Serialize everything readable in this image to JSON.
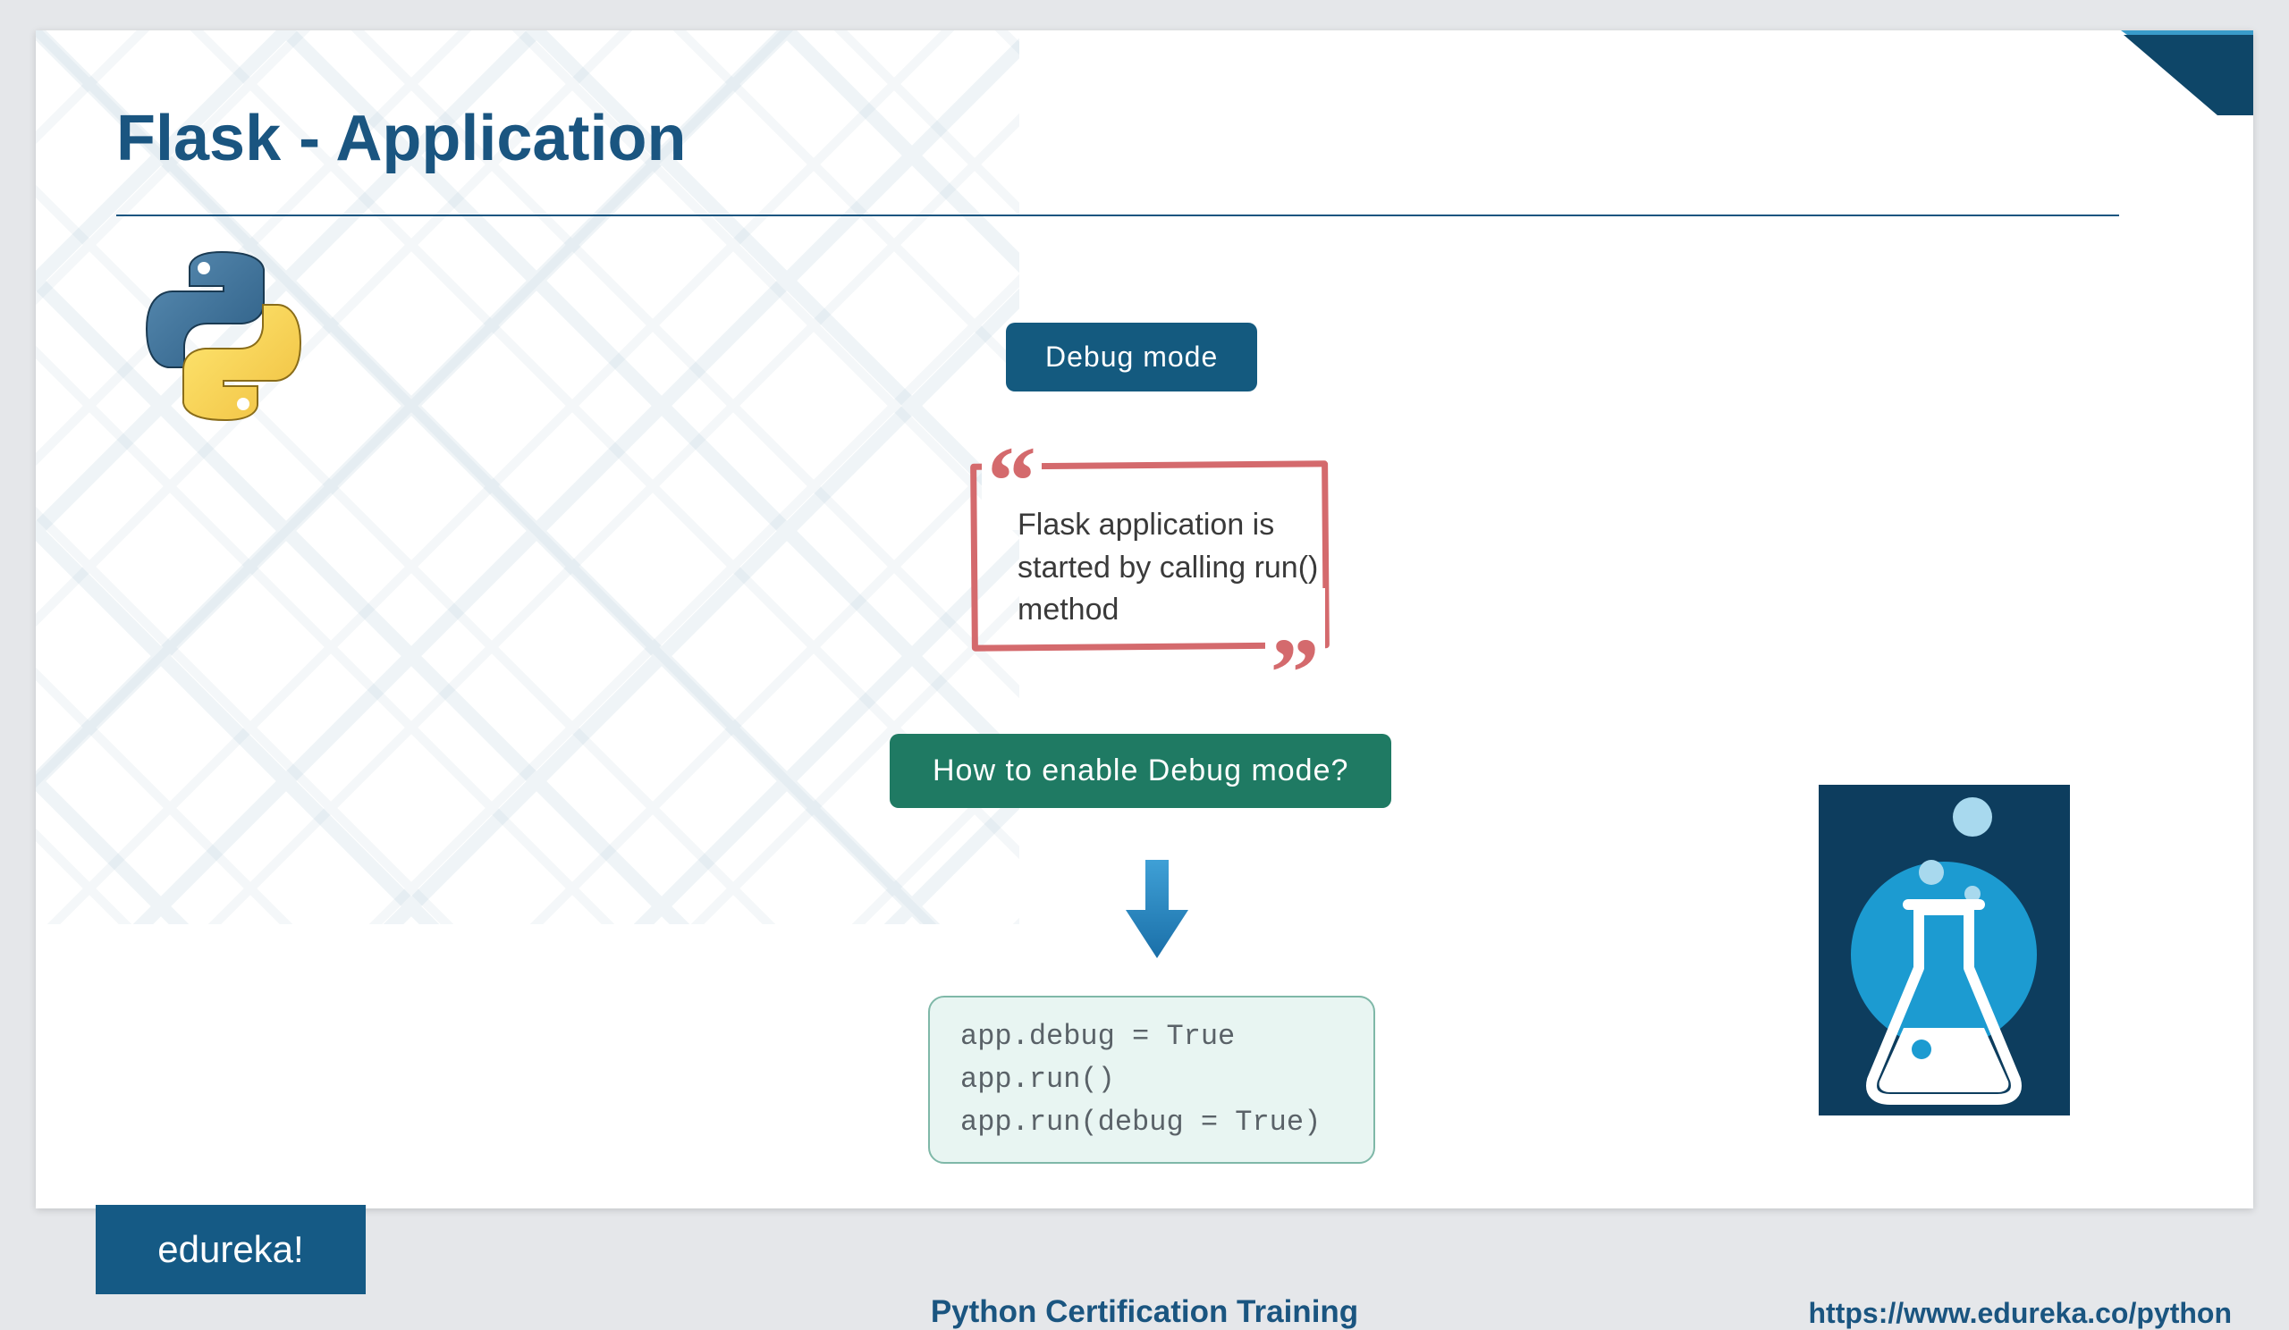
{
  "slide": {
    "title": "Flask - Application",
    "badge_blue": "Debug mode",
    "quote_text": "Flask application is started by calling run() method",
    "badge_green": "How to enable Debug mode?",
    "code": "app.debug = True\napp.run()\napp.run(debug = True)"
  },
  "footer": {
    "brand": "edureka!",
    "course": "Python Certification Training",
    "url": "https://www.edureka.co/python"
  }
}
